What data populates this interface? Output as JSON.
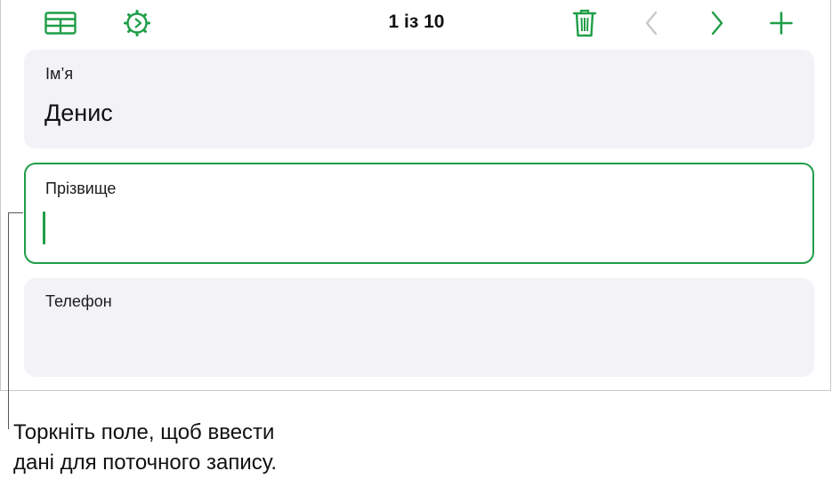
{
  "toolbar": {
    "record_counter": "1 із 10",
    "icons": {
      "table": "table-view-icon",
      "settings": "gear-icon",
      "trash": "trash-icon",
      "prev": "chevron-left-icon",
      "next": "chevron-right-icon",
      "add": "plus-icon"
    },
    "accent_color": "#1f9e48",
    "disabled_color": "#c7c7cc"
  },
  "form": {
    "fields": [
      {
        "label": "Ім’я",
        "value": "Денис"
      },
      {
        "label": "Прізвище",
        "value": ""
      },
      {
        "label": "Телефон",
        "value": ""
      }
    ]
  },
  "callout": {
    "line1": "Торкніть поле, щоб ввести",
    "line2": "дані для поточного запису."
  }
}
